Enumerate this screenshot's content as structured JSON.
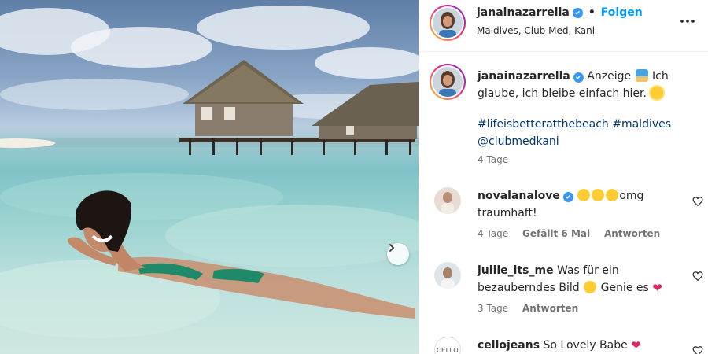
{
  "post": {
    "author": "janainazarrella",
    "follow_label": "Folgen",
    "separator": "•",
    "location": "Maldives, Club Med, Kani",
    "caption_prefix": "Anzeige",
    "caption_body": "Ich glaube, ich bleibe einfach hier.",
    "hashtags": "#lifeisbetteratthebeach #maldives @clubmedkani",
    "time": "4 Tage"
  },
  "comments": [
    {
      "user": "novalanalove",
      "verified": true,
      "text": "omg traumhaft!",
      "time": "4 Tage",
      "likes": "Gefällt 6 Mal",
      "reply": "Antworten"
    },
    {
      "user": "juliie_its_me",
      "verified": false,
      "text_a": "Was für ein bezauberndes Bild",
      "text_b": "Genie es",
      "time": "3 Tage",
      "reply": "Antworten"
    },
    {
      "user": "cellojeans",
      "verified": false,
      "text": "So Lovely Babe",
      "avatar_text": "CELLO"
    }
  ],
  "icons": {
    "verified": "verified-badge-icon",
    "more": "more-options-icon",
    "heart": "heart-outline-icon",
    "next": "chevron-right-icon"
  },
  "colors": {
    "link": "#00376b",
    "follow": "#0095f6",
    "muted": "#737373",
    "verified": "#3897f0"
  }
}
